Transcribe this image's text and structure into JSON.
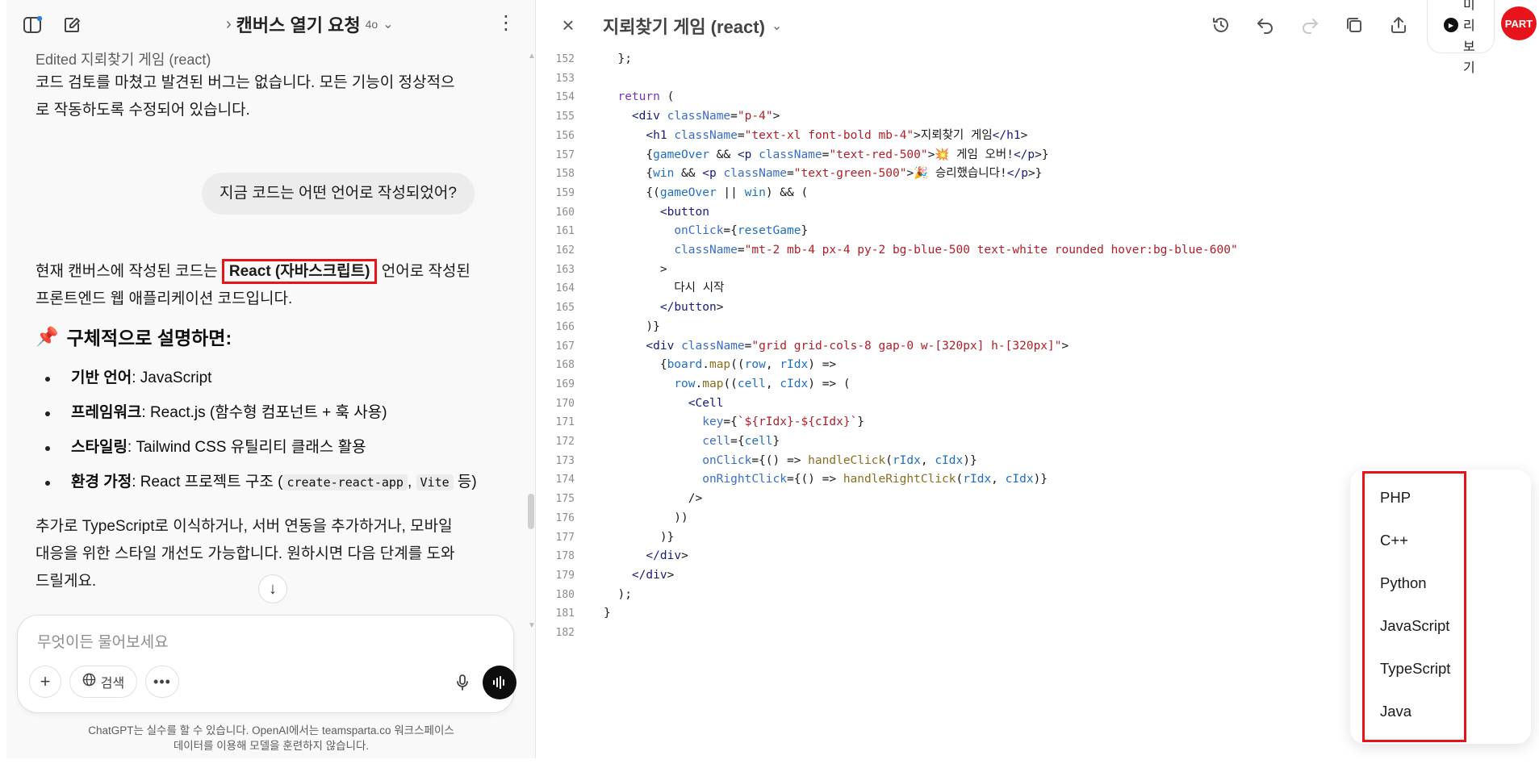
{
  "chat": {
    "title": "캔버스 열기 요청",
    "model": "4o",
    "edited_label": "Edited 지뢰찾기 게임 (react)",
    "msg1_line1": "코드 검토를 마쳤고 발견된 버그는 없습니다. 모든 기능이 정상적으",
    "msg1_line2": "로 작동하도록 수정되어 있습니다.",
    "user_message": "지금 코드는 어떤 언어로 작성되었어?",
    "answer_prefix": "현재 캔버스에 작성된 코드는",
    "answer_highlight": "React (자바스크립트)",
    "answer_suffix": "언어로 작성된",
    "answer_line2": "프론트엔드 웹 애플리케이션 코드입니다.",
    "heading_emoji": "📌",
    "heading": "구체적으로 설명하면:",
    "bullets": [
      {
        "label": "기반 언어",
        "text": ": JavaScript"
      },
      {
        "label": "프레임워크",
        "text": ": React.js (함수형 컴포넌트 + 훅 사용)"
      },
      {
        "label": "스타일링",
        "text": ": Tailwind CSS 유틸리티 클래스 활용"
      },
      {
        "label": "환경 가정",
        "text": ": React 프로젝트 구조 (",
        "code1": "create-react-app",
        "sep": ",",
        "code2": "Vite",
        "end": "등)"
      }
    ],
    "closing_line1": "추가로 TypeScript로 이식하거나, 서버 연동을 추가하거나, 모바일",
    "closing_line2": "대응을 위한 스타일 개선도 가능합니다. 원하시면 다음 단계를 도와",
    "closing_line3": "드릴게요.",
    "composer_placeholder": "무엇이든 물어보세요",
    "search_label": "검색",
    "footer_line1": "ChatGPT는 실수를 할 수 있습니다. OpenAI에서는 teamsparta.co 워크스페이스",
    "footer_line2": "데이터를 이용해 모델을 훈련하지 않습니다."
  },
  "canvas": {
    "title": "지뢰찾기 게임 (react)",
    "preview_label": "미리보기",
    "logo_text": "PART",
    "lines": [
      {
        "n": "152",
        "src": "  };"
      },
      {
        "n": "153",
        "src": ""
      },
      {
        "n": "154",
        "src": "  return ("
      },
      {
        "n": "155",
        "src": "    <div className=\"p-4\">"
      },
      {
        "n": "156",
        "src": "      <h1 className=\"text-xl font-bold mb-4\">지뢰찾기 게임</h1>"
      },
      {
        "n": "157",
        "src": "      {gameOver && <p className=\"text-red-500\">💥 게임 오버!</p>}"
      },
      {
        "n": "158",
        "src": "      {win && <p className=\"text-green-500\">🎉 승리했습니다!</p>}"
      },
      {
        "n": "159",
        "src": "      {(gameOver || win) && ("
      },
      {
        "n": "160",
        "src": "        <button"
      },
      {
        "n": "161",
        "src": "          onClick={resetGame}"
      },
      {
        "n": "162",
        "src": "          className=\"mt-2 mb-4 px-4 py-2 bg-blue-500 text-white rounded hover:bg-blue-600\""
      },
      {
        "n": "163",
        "src": "        >"
      },
      {
        "n": "164",
        "src": "          다시 시작"
      },
      {
        "n": "165",
        "src": "        </button>"
      },
      {
        "n": "166",
        "src": "      )}"
      },
      {
        "n": "167",
        "src": "      <div className=\"grid grid-cols-8 gap-0 w-[320px] h-[320px]\">"
      },
      {
        "n": "168",
        "src": "        {board.map((row, rIdx) =>"
      },
      {
        "n": "169",
        "src": "          row.map((cell, cIdx) => ("
      },
      {
        "n": "170",
        "src": "            <Cell"
      },
      {
        "n": "171",
        "src": "              key={`${rIdx}-${cIdx}`}"
      },
      {
        "n": "172",
        "src": "              cell={cell}"
      },
      {
        "n": "173",
        "src": "              onClick={() => handleClick(rIdx, cIdx)}"
      },
      {
        "n": "174",
        "src": "              onRightClick={() => handleRightClick(rIdx, cIdx)}"
      },
      {
        "n": "175",
        "src": "            />"
      },
      {
        "n": "176",
        "src": "          ))"
      },
      {
        "n": "177",
        "src": "        )}"
      },
      {
        "n": "178",
        "src": "      </div>"
      },
      {
        "n": "179",
        "src": "    </div>"
      },
      {
        "n": "180",
        "src": "  );"
      },
      {
        "n": "181",
        "src": "}"
      },
      {
        "n": "182",
        "src": ""
      }
    ]
  },
  "language_menu": {
    "items": [
      "PHP",
      "C++",
      "Python",
      "JavaScript",
      "TypeScript",
      "Java"
    ]
  },
  "colors": {
    "highlight_border": "#e8141c",
    "keyword": "#7a32b8",
    "string": "#b31d28",
    "tag": "#1a1a80"
  }
}
